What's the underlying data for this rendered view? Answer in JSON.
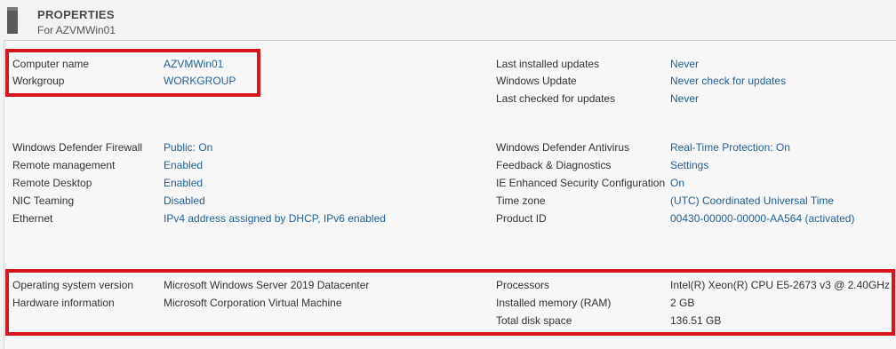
{
  "header": {
    "title": "PROPERTIES",
    "subtitle": "For AZVMWin01"
  },
  "accent": {
    "link": "#1f5f99",
    "highlight": "#d8141f"
  },
  "icons": {
    "server": "server-icon"
  },
  "rows": {
    "computer_name": {
      "label": "Computer name",
      "value": "AZVMWin01"
    },
    "workgroup": {
      "label": "Workgroup",
      "value": "WORKGROUP"
    },
    "last_installed": {
      "label": "Last installed updates",
      "value": "Never"
    },
    "windows_update": {
      "label": "Windows Update",
      "value": "Never check for updates"
    },
    "last_checked": {
      "label": "Last checked for updates",
      "value": "Never"
    },
    "firewall": {
      "label": "Windows Defender Firewall",
      "value": "Public: On"
    },
    "remote_mgmt": {
      "label": "Remote management",
      "value": "Enabled"
    },
    "remote_desktop": {
      "label": "Remote Desktop",
      "value": "Enabled"
    },
    "nic_teaming": {
      "label": "NIC Teaming",
      "value": "Disabled"
    },
    "ethernet": {
      "label": "Ethernet",
      "value": "IPv4 address assigned by DHCP, IPv6 enabled"
    },
    "antivirus": {
      "label": "Windows Defender Antivirus",
      "value": "Real-Time Protection: On"
    },
    "feedback": {
      "label": "Feedback & Diagnostics",
      "value": "Settings"
    },
    "ie_security": {
      "label": "IE Enhanced Security Configuration",
      "value": "On"
    },
    "time_zone": {
      "label": "Time zone",
      "value": "(UTC) Coordinated Universal Time"
    },
    "product_id": {
      "label": "Product ID",
      "value": "00430-00000-00000-AA564 (activated)"
    },
    "os_version": {
      "label": "Operating system version",
      "value": "Microsoft Windows Server 2019 Datacenter"
    },
    "hardware": {
      "label": "Hardware information",
      "value": "Microsoft Corporation Virtual Machine"
    },
    "processors": {
      "label": "Processors",
      "value": "Intel(R) Xeon(R) CPU E5-2673 v3 @ 2.40GHz"
    },
    "memory": {
      "label": "Installed memory (RAM)",
      "value": "2 GB"
    },
    "disk": {
      "label": "Total disk space",
      "value": "136.51 GB"
    }
  }
}
